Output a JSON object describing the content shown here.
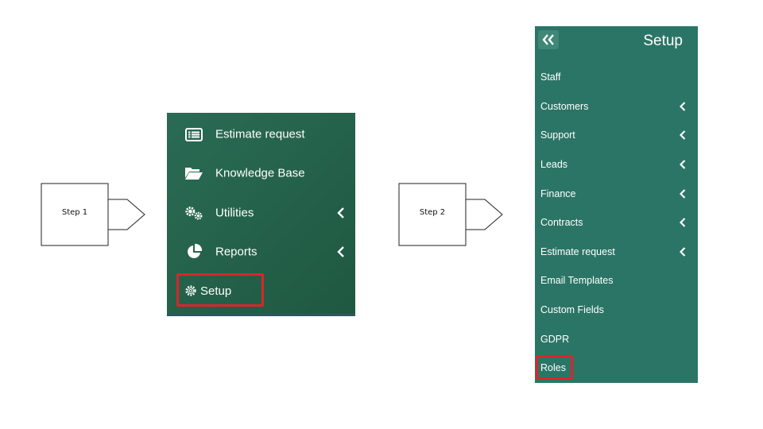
{
  "steps": [
    {
      "label": "Step 1"
    },
    {
      "label": "Step 2"
    }
  ],
  "menu_before": {
    "items": [
      {
        "label": "Estimate request",
        "icon": "list-icon",
        "has_chevron": false
      },
      {
        "label": "Knowledge Base",
        "icon": "folder-open-icon",
        "has_chevron": false
      },
      {
        "label": "Utilities",
        "icon": "cogs-icon",
        "has_chevron": true
      },
      {
        "label": "Reports",
        "icon": "pie-chart-icon",
        "has_chevron": true
      }
    ],
    "setup_label": "Setup"
  },
  "menu_setup": {
    "title": "Setup",
    "collapse_icon": "double-chevron-left-icon",
    "items": [
      {
        "label": "Staff",
        "has_chevron": false
      },
      {
        "label": "Customers",
        "has_chevron": true
      },
      {
        "label": "Support",
        "has_chevron": true
      },
      {
        "label": "Leads",
        "has_chevron": true
      },
      {
        "label": "Finance",
        "has_chevron": true
      },
      {
        "label": "Contracts",
        "has_chevron": true
      },
      {
        "label": "Estimate request",
        "has_chevron": true
      },
      {
        "label": "Email Templates",
        "has_chevron": false
      },
      {
        "label": "Custom Fields",
        "has_chevron": false
      },
      {
        "label": "GDPR",
        "has_chevron": false
      },
      {
        "label": "Roles",
        "has_chevron": false
      }
    ]
  },
  "colors": {
    "highlight": "#d9262a",
    "menu_before_bg": "#245f48",
    "menu_setup_bg": "#2b7566"
  }
}
